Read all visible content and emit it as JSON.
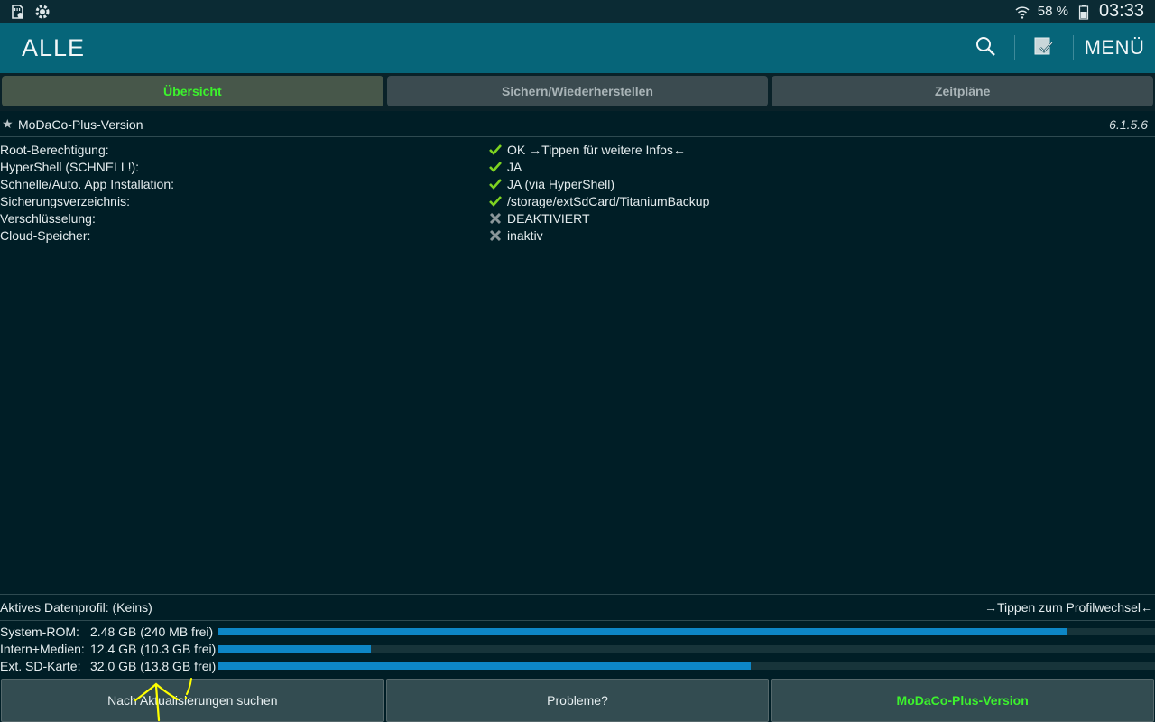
{
  "status_bar": {
    "battery_percent": "58 %",
    "time": "03:33",
    "icons": [
      "sd-card-icon",
      "titanium-icon",
      "wifi-icon",
      "battery-icon"
    ]
  },
  "action_bar": {
    "title": "ALLE",
    "menu_label": "MENÜ",
    "icons": [
      "search-icon",
      "checklist-icon"
    ]
  },
  "tabs": [
    {
      "label": "Übersicht",
      "active": true
    },
    {
      "label": "Sichern/Wiederherstellen",
      "active": false
    },
    {
      "label": "Zeitpläne",
      "active": false
    }
  ],
  "section": {
    "title": "MoDaCo-Plus-Version",
    "version": "6.1.5.6"
  },
  "info_rows": [
    {
      "label": "Root-Berechtigung:",
      "value": "OK →Tippen für weitere Infos←",
      "status": "ok"
    },
    {
      "label": "HyperShell (SCHNELL!):",
      "value": "JA",
      "status": "ok"
    },
    {
      "label": "Schnelle/Auto. App Installation:",
      "value": "JA (via HyperShell)",
      "status": "ok"
    },
    {
      "label": "Sicherungsverzeichnis:",
      "value": "/storage/extSdCard/TitaniumBackup",
      "status": "ok"
    },
    {
      "label": "Verschlüsselung:",
      "value": "DEAKTIVIERT",
      "status": "off"
    },
    {
      "label": "Cloud-Speicher:",
      "value": "inaktiv",
      "status": "off"
    }
  ],
  "profile": {
    "label": "Aktives Datenprofil:   (Keins)",
    "action": "→Tippen zum Profilwechsel←"
  },
  "storage": [
    {
      "name": "System-ROM:",
      "value": "2.48 GB (240 MB frei)",
      "used_fraction": 0.906
    },
    {
      "name": "Intern+Medien:",
      "value": "12.4 GB (10.3 GB frei)",
      "used_fraction": 0.163
    },
    {
      "name": "Ext. SD-Karte:",
      "value": "32.0 GB (13.8 GB frei)",
      "used_fraction": 0.568
    }
  ],
  "buttons": {
    "check_updates": "Nach Aktualisierungen suchen",
    "problems": "Probleme?",
    "version": "MoDaCo-Plus-Version"
  },
  "colors": {
    "ok_mark": "#7ed321",
    "off_mark": "#8a9699",
    "accent_green": "#3cf22d",
    "bar_fill": "#0d86c6",
    "annotation": "#ffff00"
  }
}
